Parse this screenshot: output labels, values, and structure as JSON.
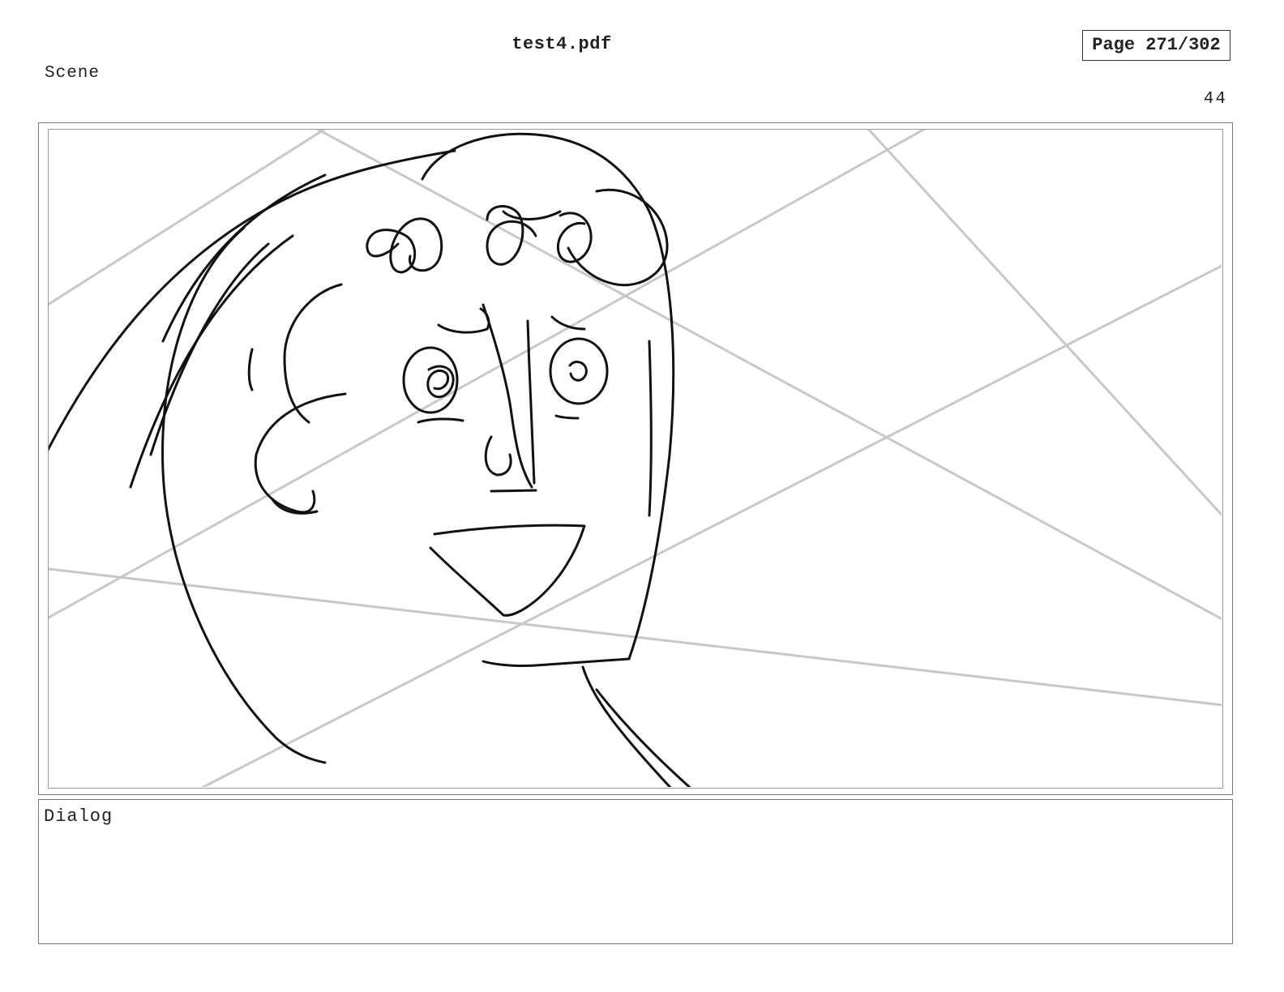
{
  "header": {
    "document_title": "test4.pdf",
    "page_indicator": "Page 271/302"
  },
  "scene": {
    "label": "Scene",
    "number": "44"
  },
  "dialog": {
    "label": "Dialog"
  },
  "panel": {
    "sketch_stroke_color": "#111111",
    "guide_line_color": "#c8c8c8",
    "frame_color": "#777777"
  }
}
